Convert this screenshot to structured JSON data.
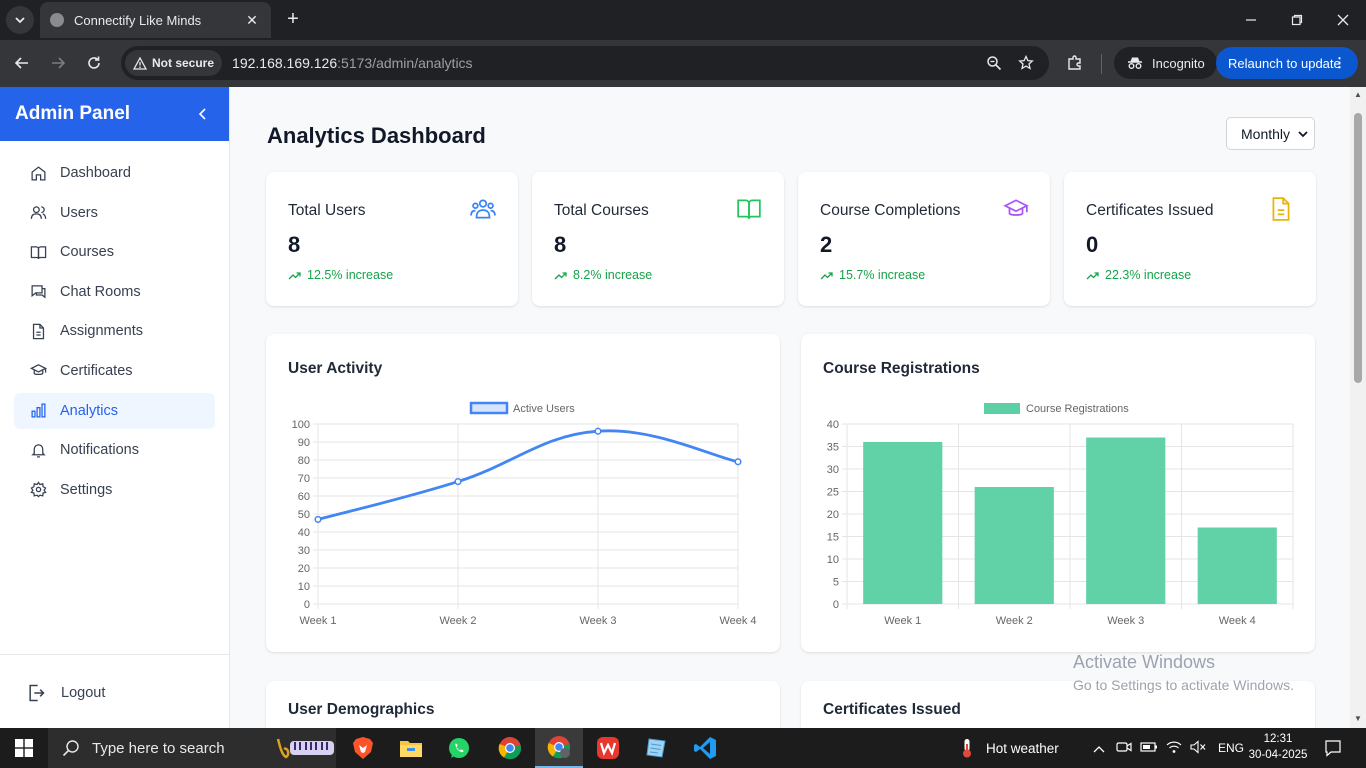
{
  "browser": {
    "tab_title": "Connectify Like Minds",
    "security_label": "Not secure",
    "url_host": "192.168.169.126",
    "url_rest": ":5173/admin/analytics",
    "incognito_label": "Incognito",
    "relaunch_label": "Relaunch to update"
  },
  "sidebar": {
    "title": "Admin Panel",
    "items": [
      {
        "label": "Dashboard",
        "icon": "home-icon"
      },
      {
        "label": "Users",
        "icon": "users-icon"
      },
      {
        "label": "Courses",
        "icon": "book-icon"
      },
      {
        "label": "Chat Rooms",
        "icon": "chat-icon"
      },
      {
        "label": "Assignments",
        "icon": "file-icon"
      },
      {
        "label": "Certificates",
        "icon": "graduation-cap-icon"
      },
      {
        "label": "Analytics",
        "icon": "bar-chart-icon",
        "active": true
      },
      {
        "label": "Notifications",
        "icon": "bell-icon"
      },
      {
        "label": "Settings",
        "icon": "gear-icon"
      }
    ],
    "logout_label": "Logout"
  },
  "main": {
    "title": "Analytics Dashboard",
    "period_selected": "Monthly"
  },
  "stats": [
    {
      "label": "Total Users",
      "value": "8",
      "trend": "12.5% increase",
      "icon": "users-icon",
      "color": "#3b82f6"
    },
    {
      "label": "Total Courses",
      "value": "8",
      "trend": "8.2% increase",
      "icon": "book-icon",
      "color": "#22c55e"
    },
    {
      "label": "Course Completions",
      "value": "2",
      "trend": "15.7% increase",
      "icon": "graduation-cap-icon",
      "color": "#a855f7"
    },
    {
      "label": "Certificates Issued",
      "value": "0",
      "trend": "22.3% increase",
      "icon": "file-icon",
      "color": "#eab308"
    }
  ],
  "panels": {
    "user_activity_title": "User Activity",
    "course_registrations_title": "Course Registrations",
    "user_demographics_title": "User Demographics",
    "certificates_issued_title": "Certificates Issued"
  },
  "chart_data": [
    {
      "type": "line",
      "title": "User Activity",
      "x": [
        "Week 1",
        "Week 2",
        "Week 3",
        "Week 4"
      ],
      "series": [
        {
          "name": "Active Users",
          "values": [
            47,
            68,
            96,
            79
          ],
          "color": "#4285f4"
        }
      ],
      "ylim": [
        0,
        100
      ],
      "yticks": [
        0,
        10,
        20,
        30,
        40,
        50,
        60,
        70,
        80,
        90,
        100
      ],
      "grid": true,
      "legend": "top-center"
    },
    {
      "type": "bar",
      "title": "Course Registrations",
      "categories": [
        "Week 1",
        "Week 2",
        "Week 3",
        "Week 4"
      ],
      "series": [
        {
          "name": "Course Registrations",
          "values": [
            36,
            26,
            37,
            17
          ],
          "color": "#5ccfa5"
        }
      ],
      "ylim": [
        0,
        40
      ],
      "yticks": [
        0,
        5,
        10,
        15,
        20,
        25,
        30,
        35,
        40
      ],
      "grid": true,
      "legend": "top-center"
    }
  ],
  "watermark": {
    "line1": "Activate Windows",
    "line2": "Go to Settings to activate Windows."
  },
  "taskbar": {
    "search_placeholder": "Type here to search",
    "weather": "Hot weather",
    "language": "ENG",
    "time": "12:31",
    "date": "30-04-2025"
  }
}
